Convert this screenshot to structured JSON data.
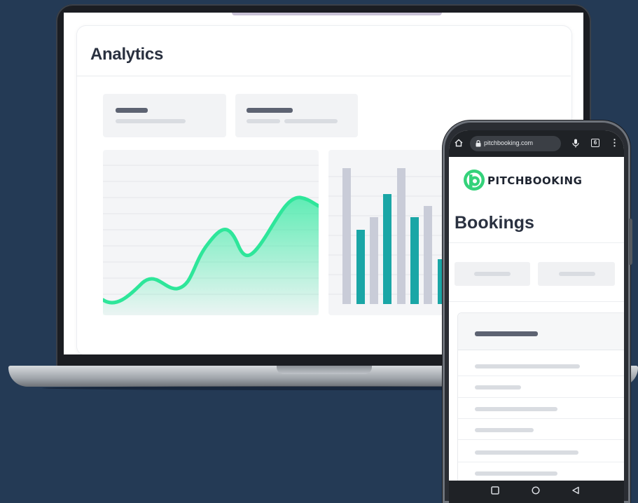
{
  "laptop": {
    "analytics_title": "Analytics",
    "colors": {
      "line": "#2ee69a",
      "bar_primary": "#1aa6a6",
      "bar_secondary": "#c9ccd8"
    }
  },
  "phone": {
    "url": "pitchbooking.com",
    "tab_count": "6",
    "brand_name": "PITCHBOOKING",
    "bookings_title": "Bookings",
    "brand_color": "#34d27a",
    "icons": [
      "home-icon",
      "lock-icon",
      "microphone-icon",
      "tabs-icon",
      "more-menu-icon",
      "square-nav-icon",
      "circle-nav-icon",
      "back-triangle-icon"
    ]
  }
}
